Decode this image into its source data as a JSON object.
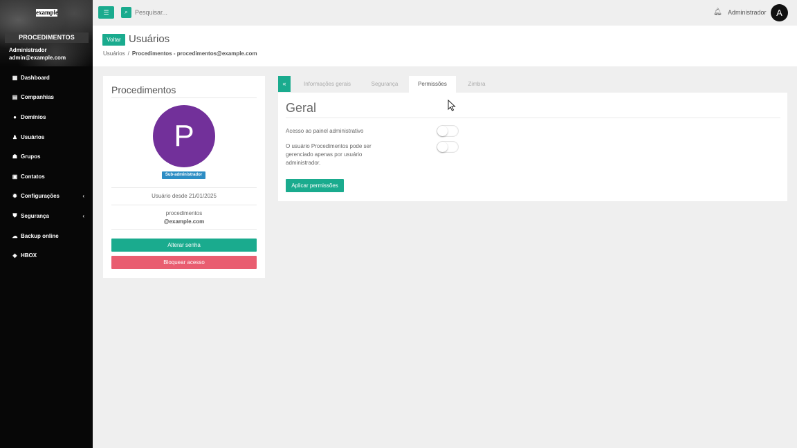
{
  "sidebar": {
    "logo_text": "example",
    "company": "PROCEDIMENTOS",
    "user_name": "Administrador",
    "user_email": "admin@example.com",
    "items": [
      {
        "label": "Dashboard",
        "icon": "dashboard-icon"
      },
      {
        "label": "Companhias",
        "icon": "building-icon"
      },
      {
        "label": "Domínios",
        "icon": "globe-icon"
      },
      {
        "label": "Usuários",
        "icon": "user-icon"
      },
      {
        "label": "Grupos",
        "icon": "users-icon"
      },
      {
        "label": "Contatos",
        "icon": "address-card-icon"
      },
      {
        "label": "Configurações",
        "icon": "gear-icon",
        "has_submenu": true
      },
      {
        "label": "Segurança",
        "icon": "shield-icon",
        "has_submenu": true
      },
      {
        "label": "Backup online",
        "icon": "cloud-upload-icon"
      },
      {
        "label": "HBOX",
        "icon": "cube-icon"
      }
    ]
  },
  "topbar": {
    "search_placeholder": "Pesquisar...",
    "admin_name": "Administrador",
    "admin_initial": "A"
  },
  "header": {
    "back_label": "Voltar",
    "title": "Usuários",
    "breadcrumb_root": "Usuários",
    "breadcrumb_sep": "/",
    "breadcrumb_current": "Procedimentos - procedimentos@example.com"
  },
  "profile": {
    "title": "Procedimentos",
    "avatar_initial": "P",
    "role_badge": "Sub-administrador",
    "since": "Usuário desde 21/01/2025",
    "login": "procedimentos",
    "domain": "@example.com",
    "change_password_label": "Alterar senha",
    "block_access_label": "Bloquear acesso"
  },
  "tabs": [
    {
      "label": "Informações gerais",
      "active": false
    },
    {
      "label": "Segurança",
      "active": false
    },
    {
      "label": "Permissões",
      "active": true
    },
    {
      "label": "Zimbra",
      "active": false
    }
  ],
  "permissions": {
    "title": "Geral",
    "items": [
      {
        "label": "Acesso ao painel administrativo",
        "enabled": false
      },
      {
        "label": "O usuário Procedimentos pode ser gerenciado apenas por usuário administrador.",
        "enabled": false
      }
    ],
    "apply_label": "Aplicar permissões"
  },
  "colors": {
    "accent": "#1aab8e",
    "danger": "#e95d70",
    "badge": "#2d8dc4",
    "avatar": "#72309a",
    "sidebar": "#070707"
  }
}
